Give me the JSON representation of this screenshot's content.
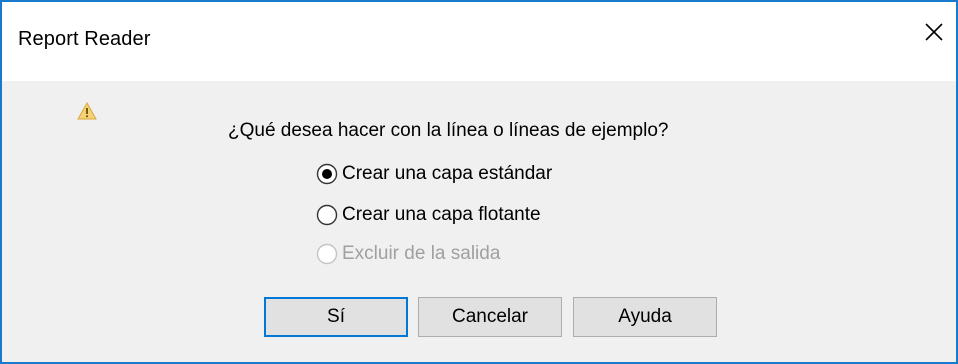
{
  "window": {
    "title": "Report Reader",
    "close_icon": "close-icon"
  },
  "message": {
    "icon": "warning-icon",
    "text": "¿Qué desea hacer con la línea o líneas de ejemplo?"
  },
  "options": [
    {
      "label": "Crear una capa estándar",
      "selected": true,
      "enabled": true
    },
    {
      "label": "Crear una capa flotante",
      "selected": false,
      "enabled": true
    },
    {
      "label": "Excluir de la salida",
      "selected": false,
      "enabled": false
    }
  ],
  "buttons": {
    "yes": "Sí",
    "cancel": "Cancelar",
    "help": "Ayuda"
  },
  "colors": {
    "window_border": "#1979ca",
    "default_button_border": "#0078d7",
    "warning_fill": "#f5d27a",
    "disabled_text": "#a0a0a0"
  }
}
